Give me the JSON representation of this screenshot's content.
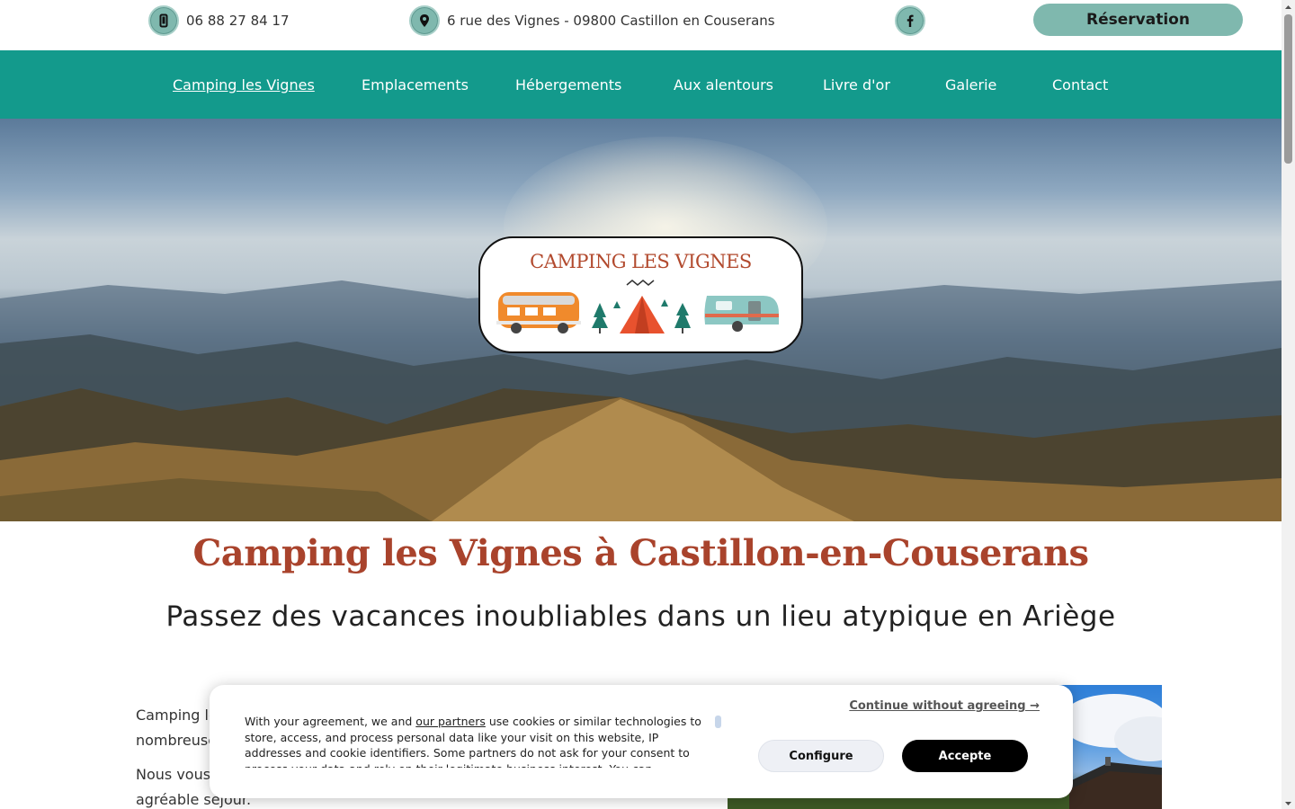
{
  "topbar": {
    "phone": "06 88 27 84 17",
    "address": "6 rue des Vignes - 09800 Castillon en Couserans",
    "reservation_label": "Réservation"
  },
  "nav": {
    "items": [
      {
        "label": "Camping les Vignes"
      },
      {
        "label": "Emplacements"
      },
      {
        "label": "Hébergements"
      },
      {
        "label": "Aux alentours"
      },
      {
        "label": "Livre d'or"
      },
      {
        "label": "Galerie"
      },
      {
        "label": "Contact"
      }
    ]
  },
  "hero": {
    "logo_text": "CAMPING LES VIGNES"
  },
  "main": {
    "title": "Camping les Vignes à Castillon-en-Couserans",
    "subtitle": "Passez des vacances inoubliables dans un lieu atypique en Ariège",
    "para1_line1": "Camping le",
    "para1_line2": "nombreuse",
    "para2_line1": "Nous vous",
    "para2_line2": "agréable séjour."
  },
  "cookie": {
    "text_before": "With your agreement, we and ",
    "partners_link": "our partners",
    "text_after": " use cookies or similar technologies to store, access, and process personal data like your visit on this website, IP addresses and cookie identifiers. Some partners do not ask for your consent to process your data and rely on their legitimate business interest. You can",
    "continue_label": "Continue without agreeing →",
    "configure_label": "Configure",
    "accept_label": "Accepte"
  },
  "colors": {
    "nav_bg": "#139a8c",
    "accent_light": "#7fb8ae",
    "heading_red": "#a9432c",
    "logo_red": "#b24a2e"
  },
  "icons": [
    "phone-icon",
    "map-pin-icon",
    "facebook-icon"
  ]
}
